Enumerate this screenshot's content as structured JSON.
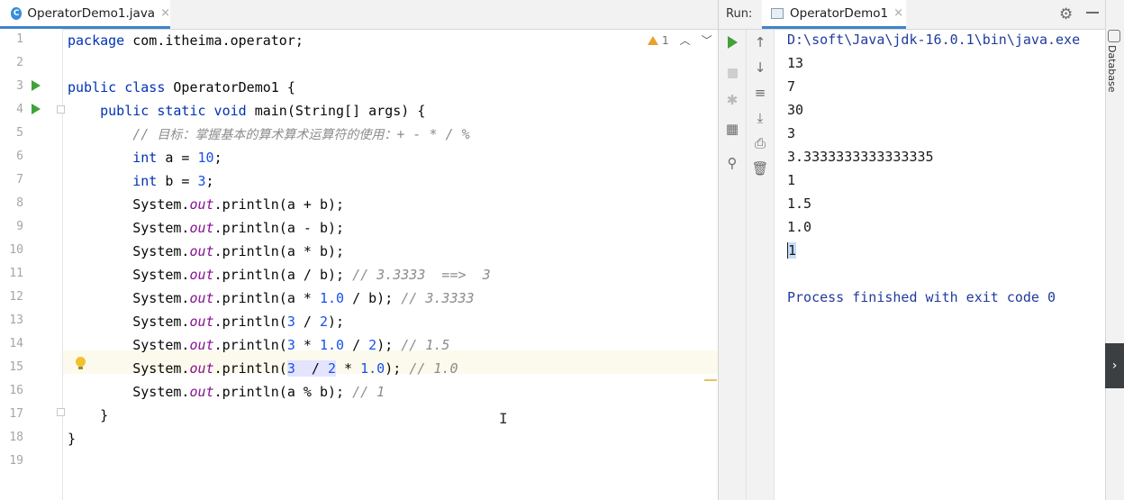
{
  "editor": {
    "tab_label": "OperatorDemo1.java",
    "tab_close": "×",
    "file_icon_letter": "C",
    "warnings_count": "1",
    "line_numbers": [
      "1",
      "2",
      "3",
      "4",
      "5",
      "6",
      "7",
      "8",
      "9",
      "10",
      "11",
      "12",
      "13",
      "14",
      "15",
      "16",
      "17",
      "18",
      "19"
    ],
    "current_line": 15
  },
  "run": {
    "label": "Run:",
    "tab_label": "OperatorDemo1",
    "tab_close": "×",
    "output": {
      "command": "D:\\soft\\Java\\jdk-16.0.1\\bin\\java.exe",
      "lines": [
        "13",
        "7",
        "30",
        "3",
        "3.3333333333333335",
        "1",
        "1.5",
        "1.0"
      ],
      "selected_line": "1",
      "exit_message": "Process finished with exit code 0"
    },
    "sidebar_label": "Database"
  },
  "colors": {
    "keyword": "#0033b3",
    "number": "#1750eb",
    "field": "#871094",
    "comment": "#8c8c8c",
    "run_green": "#42a13a",
    "console_blue": "#203b9c",
    "tab_underline": "#4083c9"
  }
}
